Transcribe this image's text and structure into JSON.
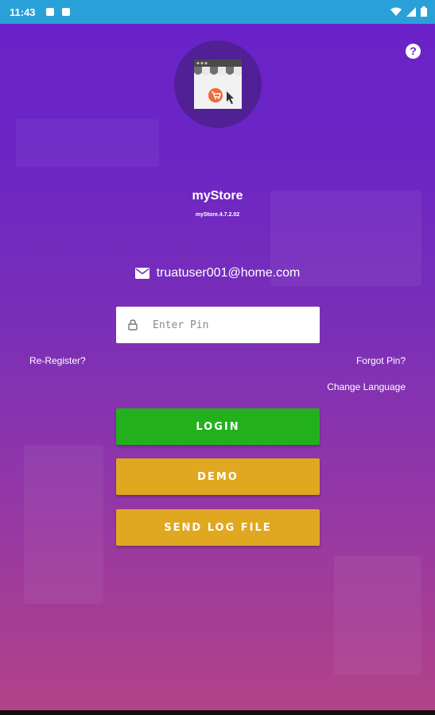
{
  "status_bar": {
    "time": "11:43",
    "icons": [
      "notification-icon",
      "sd-card-icon",
      "wifi-icon",
      "signal-icon",
      "battery-icon"
    ]
  },
  "help": {
    "label": "?"
  },
  "app": {
    "name": "myStore",
    "version": "myStore.4.7.2.02"
  },
  "user": {
    "email": "truatuser001@home.com"
  },
  "pin": {
    "placeholder": "Enter Pin",
    "value": ""
  },
  "links": {
    "reregister": "Re-Register?",
    "forgot_pin": "Forgot Pin?",
    "change_language": "Change Language"
  },
  "buttons": {
    "login": "LOGIN",
    "demo": "DEMO",
    "send_log": "SEND LOG FILE"
  },
  "colors": {
    "status_bar": "#2aa0d8",
    "background_top": "#6a22c9",
    "background_bottom": "#b24488",
    "login_button": "#22b11d",
    "secondary_button": "#e0a821"
  }
}
